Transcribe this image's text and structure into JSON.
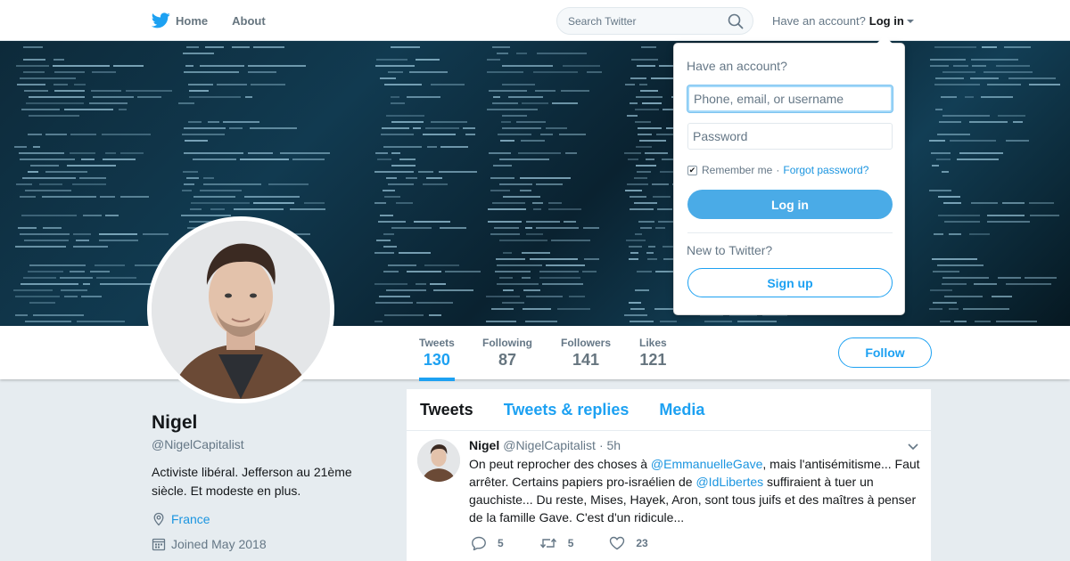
{
  "nav": {
    "home_label": "Home",
    "about_label": "About",
    "search_placeholder": "Search Twitter",
    "have_account": "Have an account?",
    "login_label": "Log in"
  },
  "profile": {
    "name": "Nigel",
    "handle": "@NigelCapitalist",
    "bio": "Activiste libéral. Jefferson au 21ème siècle. Et modeste en plus.",
    "location": "France",
    "joined": "Joined May 2018",
    "follow_label": "Follow",
    "stats": [
      {
        "label": "Tweets",
        "value": "130"
      },
      {
        "label": "Following",
        "value": "87"
      },
      {
        "label": "Followers",
        "value": "141"
      },
      {
        "label": "Likes",
        "value": "121"
      }
    ]
  },
  "timeline": {
    "tabs": [
      "Tweets",
      "Tweets & replies",
      "Media"
    ],
    "tweet": {
      "name": "Nigel",
      "handle": "@NigelCapitalist",
      "time": "· 5h",
      "text_part1": "On peut reprocher des choses à ",
      "mention1": "@EmmanuelleGave",
      "text_part2": ", mais l'antisémitisme... Faut arrêter. Certains papiers pro-israélien de ",
      "mention2": "@IdLibertes",
      "text_part3": " suffiraient à tuer un gauchiste... Du reste, Mises, Hayek, Aron, sont tous juifs et des maîtres à penser de la famille Gave. C'est d'un ridicule...",
      "replies": "5",
      "retweets": "5",
      "likes": "23"
    }
  },
  "login_dropdown": {
    "title": "Have an account?",
    "user_placeholder": "Phone, email, or username",
    "pass_placeholder": "Password",
    "remember": "Remember me",
    "separator": "·",
    "forgot": "Forgot password?",
    "login_button": "Log in",
    "new_to_twitter": "New to Twitter?",
    "signup_button": "Sign up"
  },
  "colors": {
    "accent": "#1da1f2",
    "login_button": "#4aabe7",
    "banner_dark": "#0d2a3a"
  },
  "icons": {
    "brand": "twitter-bird-icon",
    "search": "search-icon",
    "location": "location-pin-icon",
    "calendar": "calendar-icon",
    "reply": "reply-icon",
    "retweet": "retweet-icon",
    "like": "heart-icon",
    "more": "chevron-down-icon"
  }
}
